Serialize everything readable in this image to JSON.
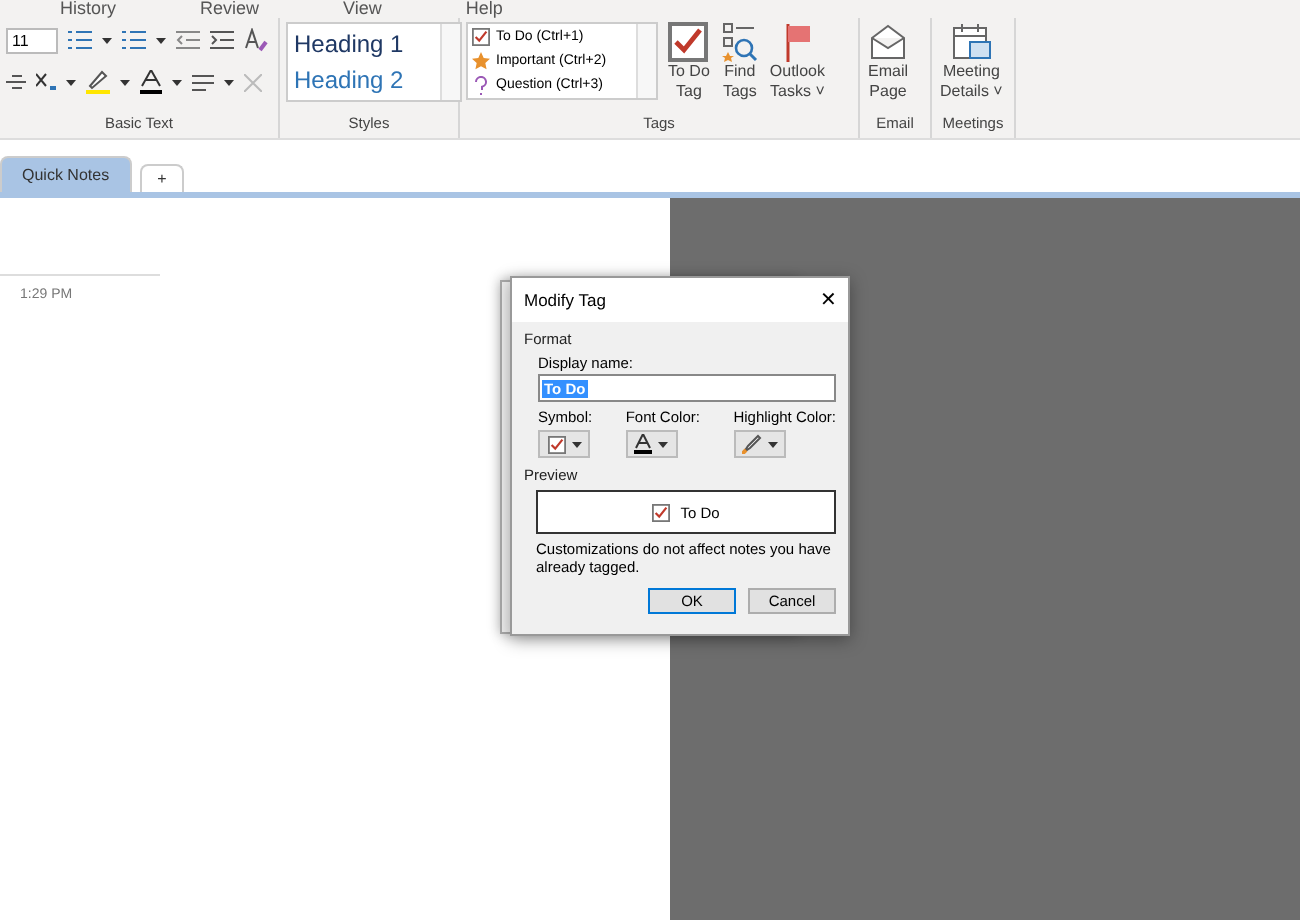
{
  "menu_tabs": [
    "History",
    "Review",
    "View",
    "Help"
  ],
  "ribbon": {
    "basic_text": {
      "font_size": "11",
      "label": "Basic Text"
    },
    "styles": {
      "items": [
        "Heading 1",
        "Heading 2"
      ],
      "label": "Styles"
    },
    "tags": {
      "items": [
        {
          "kind": "check",
          "label": "To Do (Ctrl+1)"
        },
        {
          "kind": "star",
          "label": "Important (Ctrl+2)"
        },
        {
          "kind": "question",
          "label": "Question (Ctrl+3)"
        }
      ],
      "buttons": [
        {
          "kind": "todo",
          "lines": [
            "To Do",
            "Tag"
          ]
        },
        {
          "kind": "find",
          "lines": [
            "Find",
            "Tags"
          ]
        },
        {
          "kind": "flag",
          "lines": [
            "Outlook",
            "Tasks ˅"
          ]
        }
      ],
      "label": "Tags"
    },
    "email": {
      "lines": [
        "Email",
        "Page"
      ],
      "label": "Email"
    },
    "meetings": {
      "lines": [
        "Meeting",
        "Details ˅"
      ],
      "label": "Meetings"
    }
  },
  "section_tabs": [
    {
      "label": "Quick Notes",
      "selected": true
    },
    {
      "label": "+",
      "selected": false
    }
  ],
  "page": {
    "time": "1:29 PM"
  },
  "dialog": {
    "title": "Modify Tag",
    "close": "✕",
    "format_label": "Format",
    "display_name_label": "Display name:",
    "display_name": "To Do",
    "pickers": [
      {
        "kind": "symbol",
        "label": "Symbol:"
      },
      {
        "kind": "font",
        "label": "Font Color:"
      },
      {
        "kind": "highlight",
        "label": "Highlight Color:"
      }
    ],
    "preview_label": "Preview",
    "preview_text": "To Do",
    "note": "Customizations do not affect notes you have already tagged.",
    "buttons": [
      {
        "label": "OK",
        "selected": true
      },
      {
        "label": "Cancel",
        "selected": false
      }
    ]
  }
}
